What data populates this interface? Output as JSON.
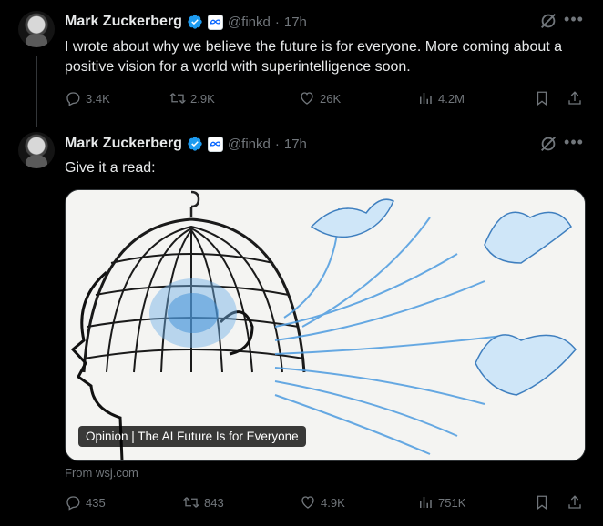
{
  "tweets": [
    {
      "author_name": "Mark Zuckerberg",
      "handle": "@finkd",
      "separator": "·",
      "time": "17h",
      "text": "I wrote about why we believe the future is for everyone. More coming about a positive vision for a world with superintelligence soon.",
      "stats": {
        "replies": "3.4K",
        "reposts": "2.9K",
        "likes": "26K",
        "views": "4.2M"
      }
    },
    {
      "author_name": "Mark Zuckerberg",
      "handle": "@finkd",
      "separator": "·",
      "time": "17h",
      "text": "Give it a read:",
      "card": {
        "caption": "Opinion | The AI Future Is for Everyone",
        "source": "From wsj.com"
      },
      "stats": {
        "replies": "435",
        "reposts": "843",
        "likes": "4.9K",
        "views": "751K"
      }
    }
  ],
  "icons": {
    "verified": "verified-badge-icon",
    "affiliation": "meta-logo-icon",
    "grok": "grok-icon",
    "more": "more-icon",
    "reply": "reply-icon",
    "repost": "repost-icon",
    "like": "like-icon",
    "views": "views-icon",
    "bookmark": "bookmark-icon",
    "share": "share-icon"
  },
  "colors": {
    "background": "#000000",
    "text_primary": "#e7e9ea",
    "text_secondary": "#71767b",
    "verified_blue": "#1d9bf0",
    "divider": "#2f3336"
  }
}
